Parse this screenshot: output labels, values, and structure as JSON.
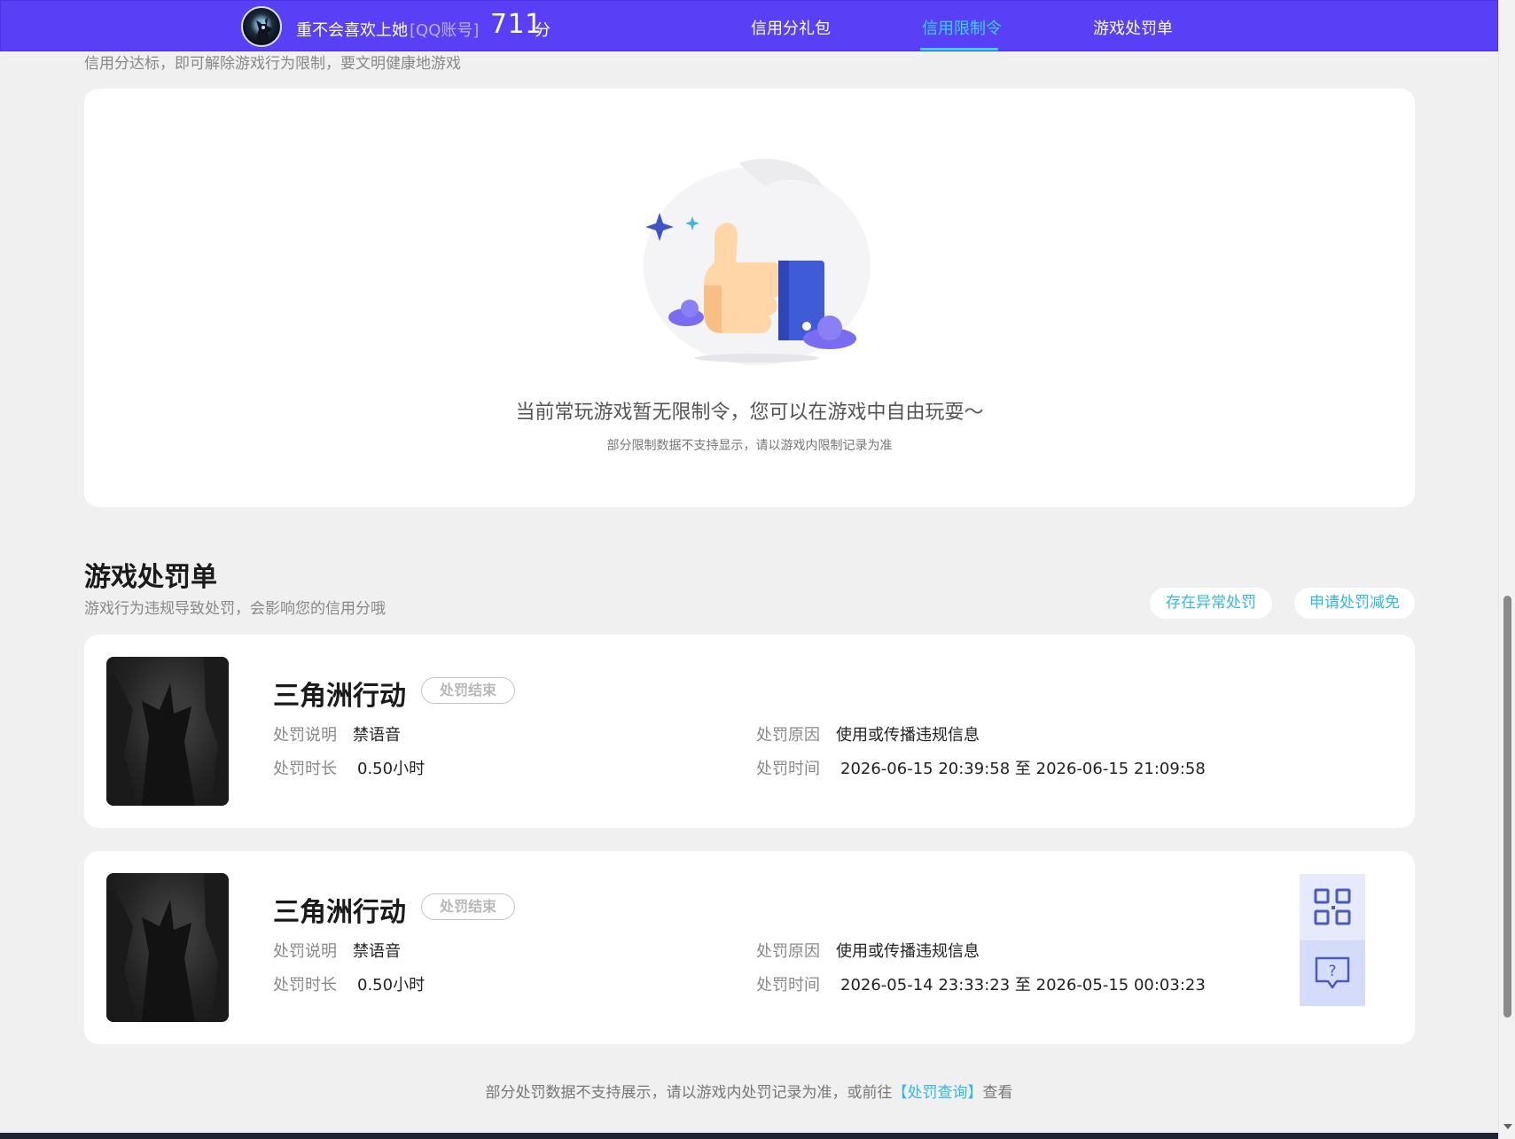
{
  "header": {
    "username": "重不会喜欢上她",
    "account_type": "[QQ账号]",
    "score": "711",
    "score_unit": "分",
    "nav": [
      {
        "label": "信用分礼包",
        "active": false
      },
      {
        "label": "信用限制令",
        "active": true
      },
      {
        "label": "游戏处罚单",
        "active": false
      }
    ],
    "active_color": "#39d3f5",
    "bar_color": "#5940f7"
  },
  "restriction": {
    "subline": "信用分达标，即可解除游戏行为限制，要文明健康地游戏",
    "empty_message": "当前常玩游戏暂无限制令，您可以在游戏中自由玩耍～",
    "empty_note": "部分限制数据不支持显示，请以游戏内限制记录为准",
    "illustration_icon": "thumbs-up-illustration"
  },
  "penalty_section": {
    "title": "游戏处罚单",
    "subtitle": "游戏行为违规导致处罚，会影响您的信用分哦",
    "btn_abnormal": "存在异常处罚",
    "btn_appeal": "申请处罚减免",
    "labels": {
      "desc": "处罚说明",
      "duration": "处罚时长",
      "reason": "处罚原因",
      "time": "处罚时间"
    },
    "items": [
      {
        "game": "三角洲行动",
        "status": "处罚结束",
        "desc": "禁语音",
        "duration": "0.50小时",
        "reason": "使用或传播违规信息",
        "time": "2026-06-15 20:39:58 至 2026-06-15 21:09:58"
      },
      {
        "game": "三角洲行动",
        "status": "处罚结束",
        "desc": "禁语音",
        "duration": "0.50小时",
        "reason": "使用或传播违规信息",
        "time": "2026-05-14 23:33:23 至 2026-05-15 00:03:23"
      }
    ]
  },
  "side_tools": {
    "top_icon": "qr-code-icon",
    "bottom_icon": "help-chat-icon"
  },
  "footer": {
    "note_prefix": "部分处罚数据不支持展示，请以游戏内处罚记录为准，或前往",
    "link_text": "【处罚查询】",
    "note_suffix": "查看"
  }
}
